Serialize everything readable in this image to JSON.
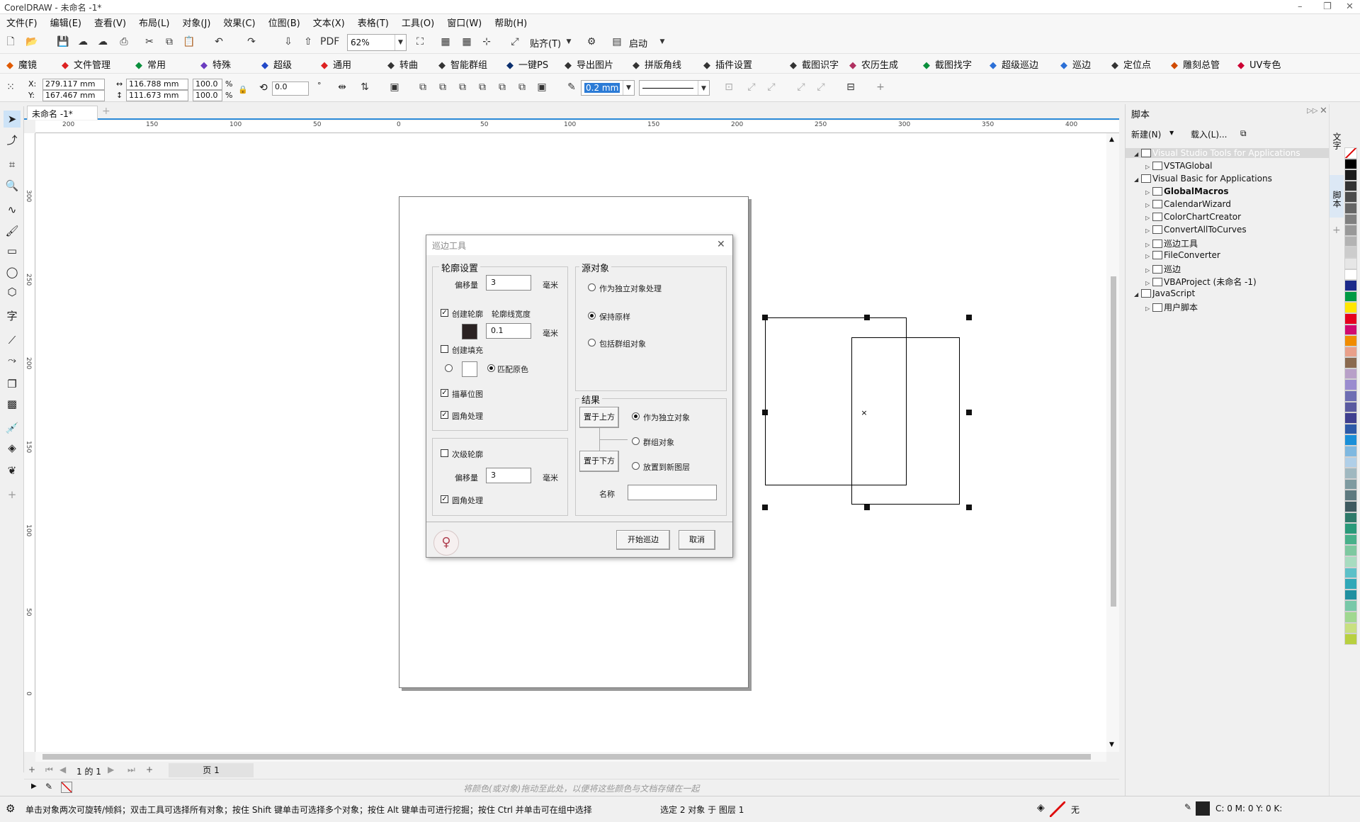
{
  "window": {
    "title": "CorelDRAW - 未命名 -1*"
  },
  "menu": [
    "文件(F)",
    "编辑(E)",
    "查看(V)",
    "布局(L)",
    "对象(J)",
    "效果(C)",
    "位图(B)",
    "文本(X)",
    "表格(T)",
    "工具(O)",
    "窗口(W)",
    "帮助(H)"
  ],
  "toolbar": {
    "zoom": "62%",
    "snap_label": "贴齐(T)",
    "launch_label": "启动"
  },
  "plugins": [
    {
      "label": "魔镜",
      "icon": "mirror-icon",
      "color": "#e05a00"
    },
    {
      "label": "文件管理",
      "icon": "folder-icon",
      "color": "#d22"
    },
    {
      "label": "常用",
      "icon": "common-icon",
      "color": "#0a8f3c"
    },
    {
      "label": "特殊",
      "icon": "special-icon",
      "color": "#6a3bbf"
    },
    {
      "label": "超级",
      "icon": "super-icon",
      "color": "#2248c8"
    },
    {
      "label": "通用",
      "icon": "general-icon",
      "color": "#d22"
    },
    {
      "label": "转曲",
      "icon": "curve-icon",
      "color": "#333"
    },
    {
      "label": "智能群组",
      "icon": "group-icon",
      "color": "#333"
    },
    {
      "label": "一键PS",
      "icon": "ps-icon",
      "color": "#0b2f6e"
    },
    {
      "label": "导出图片",
      "icon": "image-icon",
      "color": "#333"
    },
    {
      "label": "拼版角线",
      "icon": "cropmark-icon",
      "color": "#333"
    },
    {
      "label": "插件设置",
      "icon": "gear-icon",
      "color": "#333"
    },
    {
      "label": "截图识字",
      "icon": "ocr-icon",
      "color": "#333"
    },
    {
      "label": "农历生成",
      "icon": "calendar-icon",
      "color": "#b03060"
    },
    {
      "label": "截图找字",
      "icon": "find-icon",
      "color": "#0a8f3c"
    },
    {
      "label": "超级巡边",
      "icon": "super-trace-icon",
      "color": "#2b6fd6"
    },
    {
      "label": "巡边",
      "icon": "trace-icon",
      "color": "#2b6fd6"
    },
    {
      "label": "定位点",
      "icon": "target-icon",
      "color": "#333"
    },
    {
      "label": "雕刻总管",
      "icon": "engrave-icon",
      "color": "#d04a00"
    },
    {
      "label": "UV专色",
      "icon": "uv-icon",
      "color": "#c03"
    }
  ],
  "props": {
    "x": "279.117 mm",
    "y": "167.467 mm",
    "w": "116.788 mm",
    "h": "111.673 mm",
    "sx": "100.0",
    "sy": "100.0",
    "pct": "%",
    "x_label": "X:",
    "y_label": "Y:",
    "angle": "0.0",
    "degree": "°",
    "outline": "0.2 mm"
  },
  "doc_tab": "未命名 -1*",
  "ruler_h": [
    "200",
    "150",
    "100",
    "50",
    "0",
    "50",
    "100",
    "150",
    "200",
    "250",
    "300",
    "350",
    "400"
  ],
  "ruler_v": [
    "300",
    "250",
    "200",
    "150",
    "100",
    "50",
    "0"
  ],
  "dialog": {
    "title": "巡边工具",
    "outline_group": "轮廓设置",
    "offset_label": "偏移量",
    "offset_value": "3",
    "unit": "毫米",
    "create_outline": "创建轮廓",
    "outline_width_label": "轮廓线宽度",
    "outline_width": "0.1",
    "create_fill": "创建填充",
    "match_color": "匹配原色",
    "trace_bitmap": "描摹位图",
    "round_corner": "圆角处理",
    "sub_outline": "次级轮廓",
    "sub_offset_label": "偏移量",
    "sub_offset": "3",
    "sub_round": "圆角处理",
    "source_group": "源对象",
    "src_opt1": "作为独立对象处理",
    "src_opt2": "保持原样",
    "src_opt3": "包括群组对象",
    "result_group": "结果",
    "place_top": "置于上方",
    "place_bottom": "置于下方",
    "res_opt1": "作为独立对象",
    "res_opt2": "群组对象",
    "res_opt3": "放置到新图层",
    "name_label": "名称",
    "start_btn": "开始巡边",
    "cancel_btn": "取消"
  },
  "page_nav": {
    "of": "1 的 1",
    "page": "页 1"
  },
  "color_hint": "将颜色(或对象)拖动至此处，以便将这些颜色与文档存储在一起",
  "status": {
    "hint": "单击对象两次可旋转/倾斜；双击工具可选择所有对象；按住 Shift 键单击可选择多个对象；按住 Alt 键单击可进行挖掘；按住 Ctrl 并单击可在组中选择",
    "selection": "选定 2 对象 于 图层 1",
    "fill": "无",
    "cmyk": "C: 0 M: 0 Y: 0 K:"
  },
  "script_panel": {
    "title": "脚本",
    "new_btn": "新建(N)",
    "load_btn": "载入(L)...",
    "tree": [
      {
        "label": "Visual Studio Tools for Applications",
        "level": 0,
        "selected": true,
        "bold": false
      },
      {
        "label": "VSTAGlobal",
        "level": 1,
        "selected": false,
        "bold": false
      },
      {
        "label": "Visual Basic for Applications",
        "level": 0,
        "selected": false,
        "bold": false
      },
      {
        "label": "GlobalMacros",
        "level": 1,
        "selected": false,
        "bold": true
      },
      {
        "label": "CalendarWizard",
        "level": 1,
        "selected": false,
        "bold": false
      },
      {
        "label": "ColorChartCreator",
        "level": 1,
        "selected": false,
        "bold": false
      },
      {
        "label": "ConvertAllToCurves",
        "level": 1,
        "selected": false,
        "bold": false
      },
      {
        "label": "巡边工具",
        "level": 1,
        "selected": false,
        "bold": false
      },
      {
        "label": "FileConverter",
        "level": 1,
        "selected": false,
        "bold": false
      },
      {
        "label": "巡边",
        "level": 1,
        "selected": false,
        "bold": false
      },
      {
        "label": "VBAProject (未命名 -1)",
        "level": 1,
        "selected": false,
        "bold": false
      },
      {
        "label": "JavaScript",
        "level": 0,
        "selected": false,
        "bold": false
      },
      {
        "label": "用户脚本",
        "level": 1,
        "selected": false,
        "bold": false
      }
    ]
  },
  "side_tabs": [
    "文字",
    "脚本"
  ],
  "palette": [
    "#ffffff",
    "#000000",
    "#1a1a1a",
    "#333333",
    "#4d4d4d",
    "#666666",
    "#808080",
    "#999999",
    "#b3b3b3",
    "#cccccc",
    "#e6e6e6",
    "#ffffff",
    "#1b2a8a",
    "#009a44",
    "#ffe600",
    "#e6001e",
    "#d10a6f",
    "#f08c00",
    "#e9a08a",
    "#8a6a4f",
    "#b8a0c8",
    "#9a8ccf",
    "#6d6db3",
    "#5a5aa0",
    "#3f3f8f",
    "#2d5aa8",
    "#1a8fd8",
    "#7fb8e0",
    "#b0cfe8",
    "#a0b8c0",
    "#7e9aa0",
    "#5e7a80",
    "#3e5a60",
    "#2e7a6a",
    "#2a9a7a",
    "#48b08a",
    "#7ec8a0",
    "#a8dcc0",
    "#5cc0c8",
    "#30a8b8",
    "#2090a0",
    "#78c8a8",
    "#a0d890",
    "#c8e080",
    "#b8d040"
  ]
}
